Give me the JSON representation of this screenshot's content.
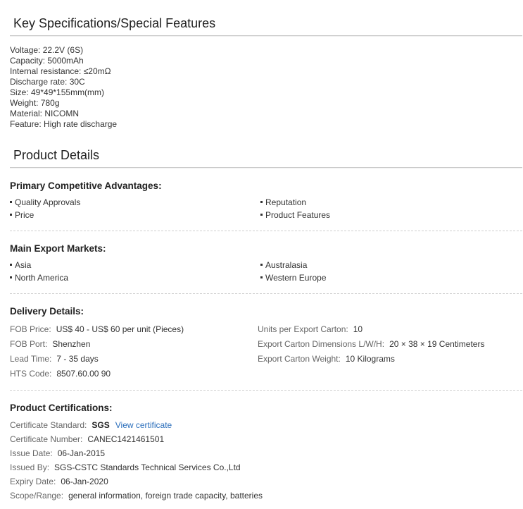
{
  "key_specs": {
    "title": "Key Specifications/Special Features",
    "items": [
      "Voltage: 22.2V (6S)",
      "Capacity: 5000mAh",
      "Internal resistance: ≤20mΩ",
      "Discharge rate: 30C",
      "Size: 49*49*155mm(mm)",
      "Weight: 780g",
      "Material: NICOMN",
      "Feature: High rate discharge"
    ]
  },
  "product_details": {
    "title": "Product Details",
    "advantages": {
      "heading": "Primary Competitive Advantages:",
      "items": [
        "Quality Approvals",
        "Reputation",
        "Price",
        "Product Features"
      ]
    },
    "markets": {
      "heading": "Main Export Markets:",
      "items": [
        "Asia",
        "Australasia",
        "North America",
        "Western Europe"
      ]
    },
    "delivery": {
      "heading": "Delivery Details:",
      "left": [
        {
          "label": "FOB Price:",
          "value": "US$ 40 - US$ 60 per unit (Pieces)"
        },
        {
          "label": "FOB Port:",
          "value": "Shenzhen"
        },
        {
          "label": "Lead Time:",
          "value": "7 - 35 days"
        },
        {
          "label": "HTS Code:",
          "value": "8507.60.00 90"
        }
      ],
      "right": [
        {
          "label": "Units per Export Carton:",
          "value": "10"
        },
        {
          "label": "Export Carton Dimensions L/W/H:",
          "value": "20 × 38 × 19 Centimeters"
        },
        {
          "label": "Export Carton Weight:",
          "value": "10 Kilograms"
        }
      ]
    },
    "certifications": {
      "heading": "Product Certifications:",
      "standard_label": "Certificate Standard:",
      "standard_value": "SGS",
      "view_link": "View certificate",
      "number_label": "Certificate Number:",
      "number_value": "CANEC1421461501",
      "issue_label": "Issue Date:",
      "issue_value": "06-Jan-2015",
      "issued_by_label": "Issued By:",
      "issued_by_value": "SGS-CSTC Standards Technical Services Co.,Ltd",
      "expiry_label": "Expiry Date:",
      "expiry_value": "06-Jan-2020",
      "scope_label": "Scope/Range:",
      "scope_value": "general information, foreign trade capacity, batteries"
    }
  }
}
